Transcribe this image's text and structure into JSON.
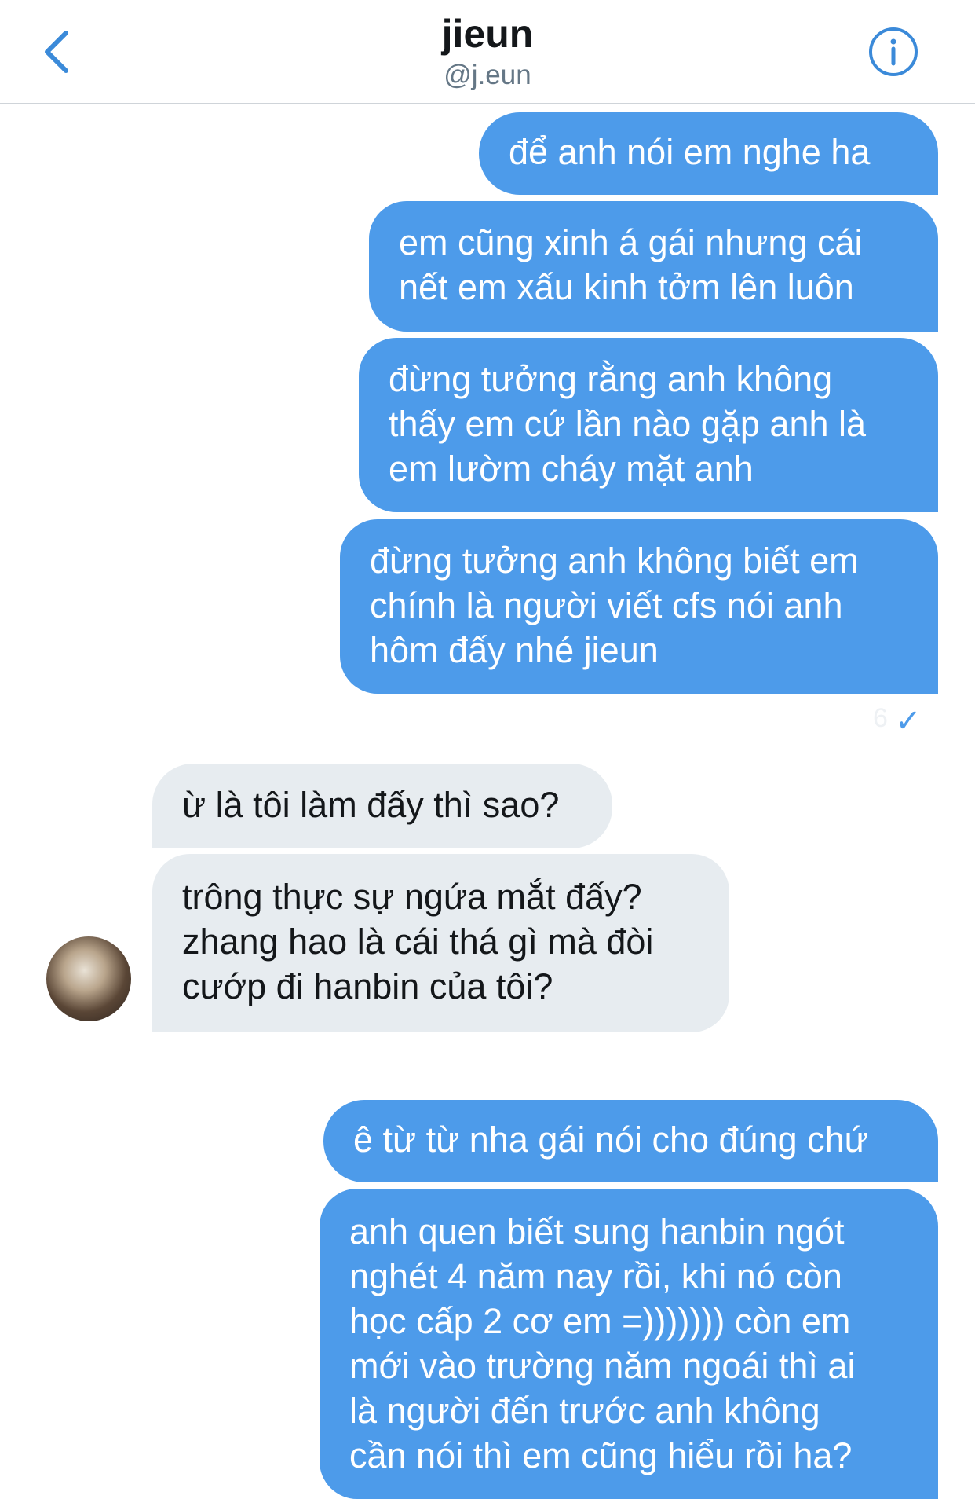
{
  "header": {
    "name": "jieun",
    "handle": "@j.eun"
  },
  "icons": {
    "back": "chevron-left-icon",
    "info": "info-icon",
    "sent": "checkmark-icon"
  },
  "colors": {
    "outgoing_bubble": "#4d9bea",
    "incoming_bubble": "#e7ecf0",
    "accent": "#4d9bea"
  },
  "messages": [
    {
      "dir": "out",
      "text": "để anh nói em nghe ha"
    },
    {
      "dir": "out",
      "text": "em cũng xinh á gái nhưng cái\nnết em xấu kinh tởm lên luôn"
    },
    {
      "dir": "out",
      "text": "đừng tưởng rằng anh không\nthấy em cứ lần nào gặp anh là\nem lườm cháy mặt anh"
    },
    {
      "dir": "out",
      "text": "đừng tưởng anh không biết em\nchính là người viết cfs nói anh\nhôm đấy nhé jieun"
    },
    {
      "dir": "in",
      "text": "ừ là tôi làm đấy thì sao?"
    },
    {
      "dir": "in",
      "text": "trông thực sự ngứa mắt đấy?\nzhang hao là cái thá gì mà đòi\ncướp đi hanbin của tôi?"
    },
    {
      "dir": "out",
      "text": "ê từ từ nha gái nói cho đúng chứ"
    },
    {
      "dir": "out",
      "text": "anh quen biết sung hanbin ngót\nnghét 4 năm nay rồi, khi nó còn\nhọc cấp 2 cơ em =))))))) còn em\nmới vào trường năm ngoái thì ai\nlà người đến trước anh không\ncần nói thì em cũng hiểu rồi ha?"
    }
  ],
  "status": {
    "faint_time": "6",
    "check": "✓"
  }
}
